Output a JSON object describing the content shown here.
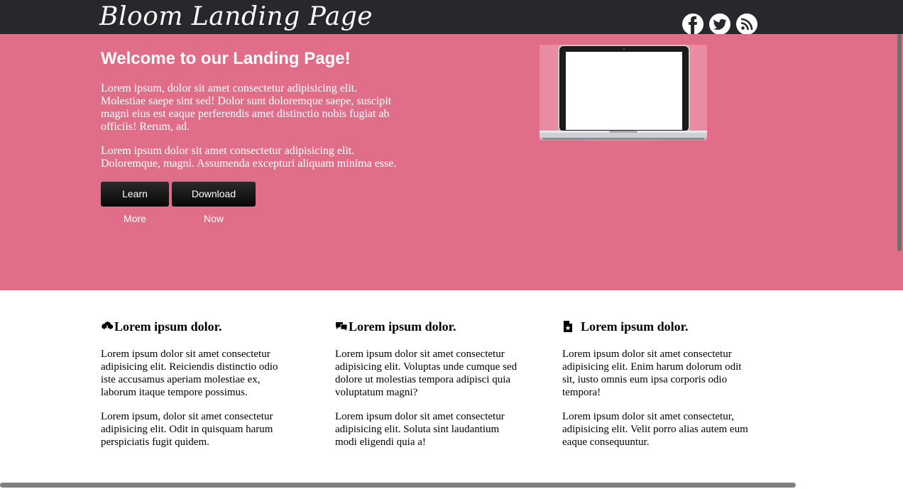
{
  "header": {
    "brand": "Bloom Landing Page",
    "social_icons": [
      "facebook-icon",
      "twitter-icon",
      "rss-icon"
    ]
  },
  "hero": {
    "title": "Welcome to our Landing Page!",
    "paragraph_1": "Lorem ipsum, dolor sit amet consectetur adipisicing elit. Molestiae saepe sint sed! Dolor sunt doloremque saepe, suscipit magni eius est eaque perferendis amet distinctio nobis fugiat ab officiis! Rerum, ad.",
    "paragraph_2": "Lorem ipsum dolor sit amet consectetur adipisicing elit. Doloremque, magni. Assumenda excepturi aliquam minima esse.",
    "buttons": {
      "learn_more": "Learn More",
      "download_now": "Download Now"
    },
    "image_icon": "laptop-icon"
  },
  "features": [
    {
      "icon": "cloud-download-icon",
      "title": "Lorem ipsum dolor.",
      "paragraph_1": "Lorem ipsum dolor sit amet consectetur adipisicing elit. Reiciendis distinctio odio iste accusamus aperiam molestiae ex, laborum itaque tempore possimus.",
      "paragraph_2": "Lorem ipsum, dolor sit amet consectetur adipisicing elit. Odit in quisquam harum perspiciatis fugit quidem."
    },
    {
      "icon": "comments-icon",
      "title": "Lorem ipsum dolor.",
      "paragraph_1": "Lorem ipsum dolor sit amet consectetur adipisicing elit. Voluptas unde cumque sed dolore ut molestias tempora adipisci quia voluptatum magni?",
      "paragraph_2": "Lorem ipsum dolor sit amet consectetur adipisicing elit. Soluta sint laudantium modi eligendi quia a!"
    },
    {
      "icon": "file-star-icon",
      "title": "Lorem ipsum dolor.",
      "paragraph_1": "Lorem ipsum dolor sit amet consectetur adipisicing elit. Enim harum dolorum odit sit, iusto omnis eum ipsa corporis odio tempora!",
      "paragraph_2": "Lorem ipsum dolor sit amet consectetur, adipisicing elit. Velit porro alias autem eum eaque consequuntur."
    }
  ],
  "colors": {
    "topbar": "#26282c",
    "hero": "#e06e88",
    "button": "#111111"
  }
}
